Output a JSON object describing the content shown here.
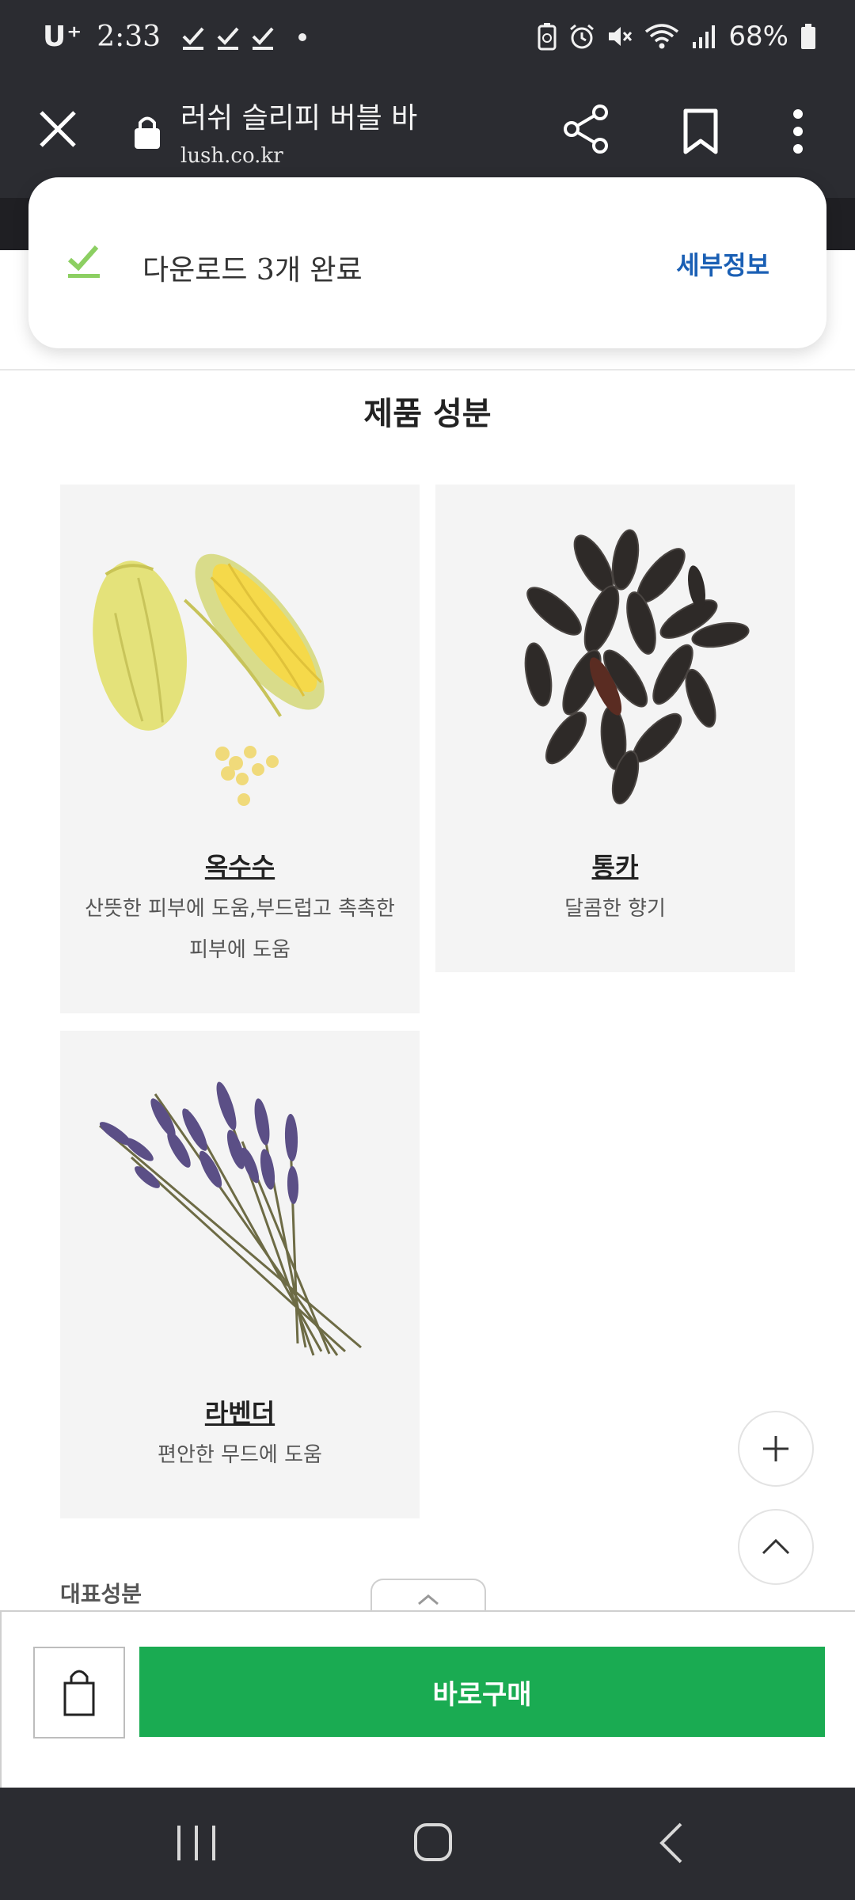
{
  "status_bar": {
    "carrier": "U⁺",
    "time": "2:33",
    "battery": "68%"
  },
  "browser": {
    "page_title": "러쉬 슬리피 버블 바",
    "url": "lush.co.kr"
  },
  "toast": {
    "message": "다운로드 3개 완료",
    "action": "세부정보"
  },
  "section": {
    "title": "제품 성분"
  },
  "ingredients": [
    {
      "name": "옥수수",
      "desc": "산뜻한 피부에 도움,부드럽고 촉촉한 피부에 도움"
    },
    {
      "name": "통카",
      "desc": "달콤한 향기"
    },
    {
      "name": "라벤더",
      "desc": "편안한 무드에 도움"
    }
  ],
  "representative_label": "대표성분",
  "buy_bar": {
    "buy_now": "바로구매"
  },
  "colors": {
    "chrome": "#2b2c31",
    "accent_green": "#1aab52",
    "link_blue": "#1a5fb4",
    "card_bg": "#f4f4f4"
  }
}
